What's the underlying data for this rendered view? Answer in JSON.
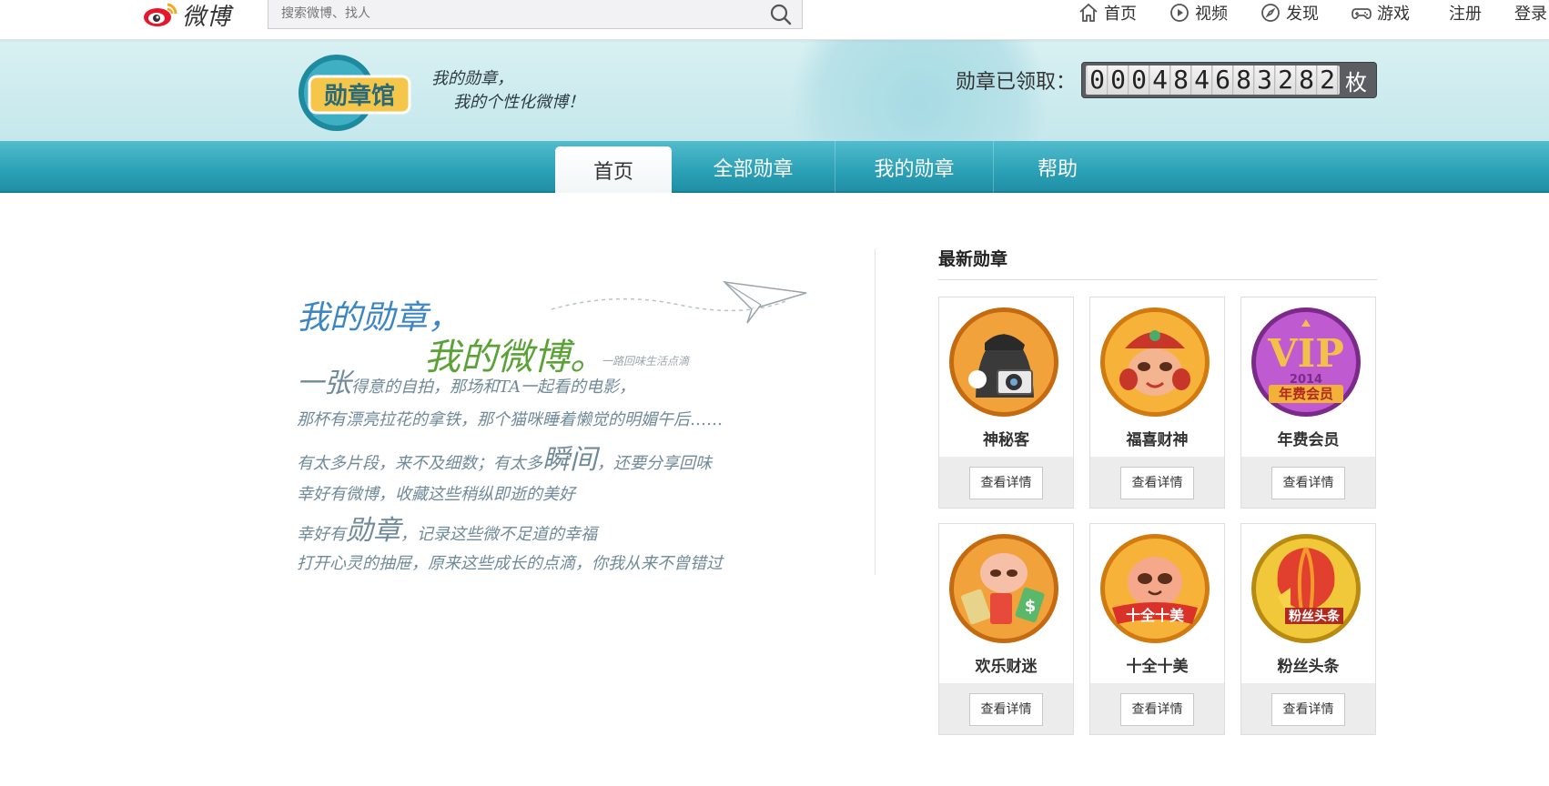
{
  "header": {
    "logo_text": "微博",
    "search_placeholder": "搜索微博、找人",
    "nav": [
      {
        "label": "首页",
        "icon": "home-icon"
      },
      {
        "label": "视频",
        "icon": "video-icon"
      },
      {
        "label": "发现",
        "icon": "compass-icon"
      },
      {
        "label": "游戏",
        "icon": "gamepad-icon"
      }
    ],
    "register": "注册",
    "login": "登录"
  },
  "banner": {
    "brand": "勋章馆",
    "slogan_line1": "我的勋章，",
    "slogan_line2": "我的个性化微博！",
    "counter_label": "勋章已领取：",
    "counter_value": "000484683282",
    "counter_unit": "枚"
  },
  "tabs": [
    {
      "label": "首页",
      "active": true
    },
    {
      "label": "全部勋章",
      "active": false
    },
    {
      "label": "我的勋章",
      "active": false
    },
    {
      "label": "帮助",
      "active": false
    }
  ],
  "intro": {
    "title1": "我的勋章，",
    "title2": "我的微博。",
    "subtitle": "一路回味生活点滴",
    "p1_big": "一张",
    "p1_rest": "得意的自拍，那场和TA一起看的电影，",
    "p1_line2": "那杯有漂亮拉花的拿铁，那个猫咪睡着懒觉的明媚午后……",
    "p2_pre": "有太多片段，来不及细数；有太多",
    "p2_big": "瞬间",
    "p2_post": "，还要分享回味",
    "p2_line2": "幸好有微博，收藏这些稍纵即逝的美好",
    "p3_pre": "幸好有",
    "p3_big": "勋章",
    "p3_post": "，记录这些微不足道的幸福",
    "p3_line2": "打开心灵的抽屉，原来这些成长的点滴，你我从来不曾错过"
  },
  "latest": {
    "title": "最新勋章",
    "button_label": "查看详情",
    "medals": [
      {
        "name": "神秘客",
        "icon": "detective-camera-medal-icon",
        "color": "#e8891c"
      },
      {
        "name": "福喜财神",
        "icon": "fortune-god-medal-icon",
        "color": "#f0a21a"
      },
      {
        "name": "年费会员",
        "icon": "vip-medal-icon",
        "color": "#a63fb5",
        "badge_year": "2014",
        "badge_text": "年费会员"
      },
      {
        "name": "欢乐财迷",
        "icon": "money-fan-medal-icon",
        "color": "#e8891c"
      },
      {
        "name": "十全十美",
        "icon": "perfect-medal-icon",
        "color": "#f0a21a",
        "badge_text": "十全十美"
      },
      {
        "name": "粉丝头条",
        "icon": "balloon-medal-icon",
        "color": "#d4a018",
        "badge_text": "粉丝头条"
      }
    ]
  }
}
